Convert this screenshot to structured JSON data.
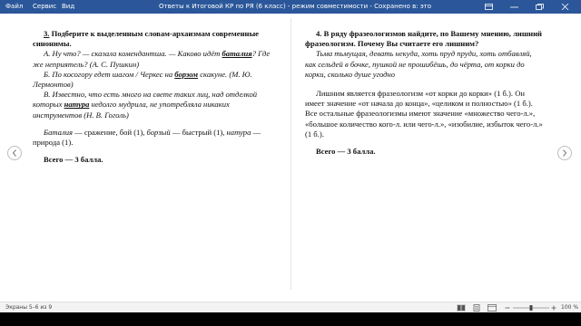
{
  "menu": {
    "file": "Файл",
    "service": "Сервис",
    "view": "Вид"
  },
  "window": {
    "title": "Ответы к Итоговой КР  по РЯ (6 класс)  -  режим совместимости  -  Сохранено в: этот компьютер  ▾"
  },
  "left_page": {
    "q_number": "3.",
    "q_text": " Подберите к выделенным словам-архаизмам современные синонимы.",
    "a_pre": "А. Ну что? — сказала комендантша. — Каково идёт ",
    "a_bold": "баталия",
    "a_post": "? Где же неприятель? (А. С. Пушкин)",
    "b_pre": "Б. По косогору едет шагом / Черкес на ",
    "b_bold": "борзом",
    "b_post": " скакуне. (М. Ю. Лермонтов)",
    "c_pre": "В. Известно, что есть много на свете таких лиц, над отделкой которых ",
    "c_bold": "натура",
    "c_post": " недолго мудрила, не употребляла никаких инструментов (Н. В. Гоголь)",
    "ans_w1": "Баталия",
    "ans_t1": " — сражение, бой (1), ",
    "ans_w2": "борзый",
    "ans_t2": " — быстрый (1), ",
    "ans_w3": "натура",
    "ans_t3": " — природа (1).",
    "total": "Всего — 3 балла."
  },
  "right_page": {
    "q_text": "4. В ряду фразеологизмов найдите, по Вашему мнению, лишний фразеологизм. Почему Вы считаете его лишним?",
    "examples": "Тьма тьмущая, девать некуда, хоть пруд пруди, хоть отбавляй, как сельдей в бочке, пушкой не прошибёшь, до чёрта, от корки до корки, сколько душе угодно",
    "answer": "Лишним является фразеологизм «от корки до корки» (1 б.). Он имеет значение «от начала до конца», «целиком и полностью» (1 б.). Все остальные фразеологизмы имеют значение «множество чего-л.», «большое количество кого-л. или чего-л.», «изобилие, избыток чего-л.» (1 б.).",
    "total": "Всего — 3 балла."
  },
  "status": {
    "screens": "Экраны 5–6 из 9",
    "zoom": "100 %"
  }
}
